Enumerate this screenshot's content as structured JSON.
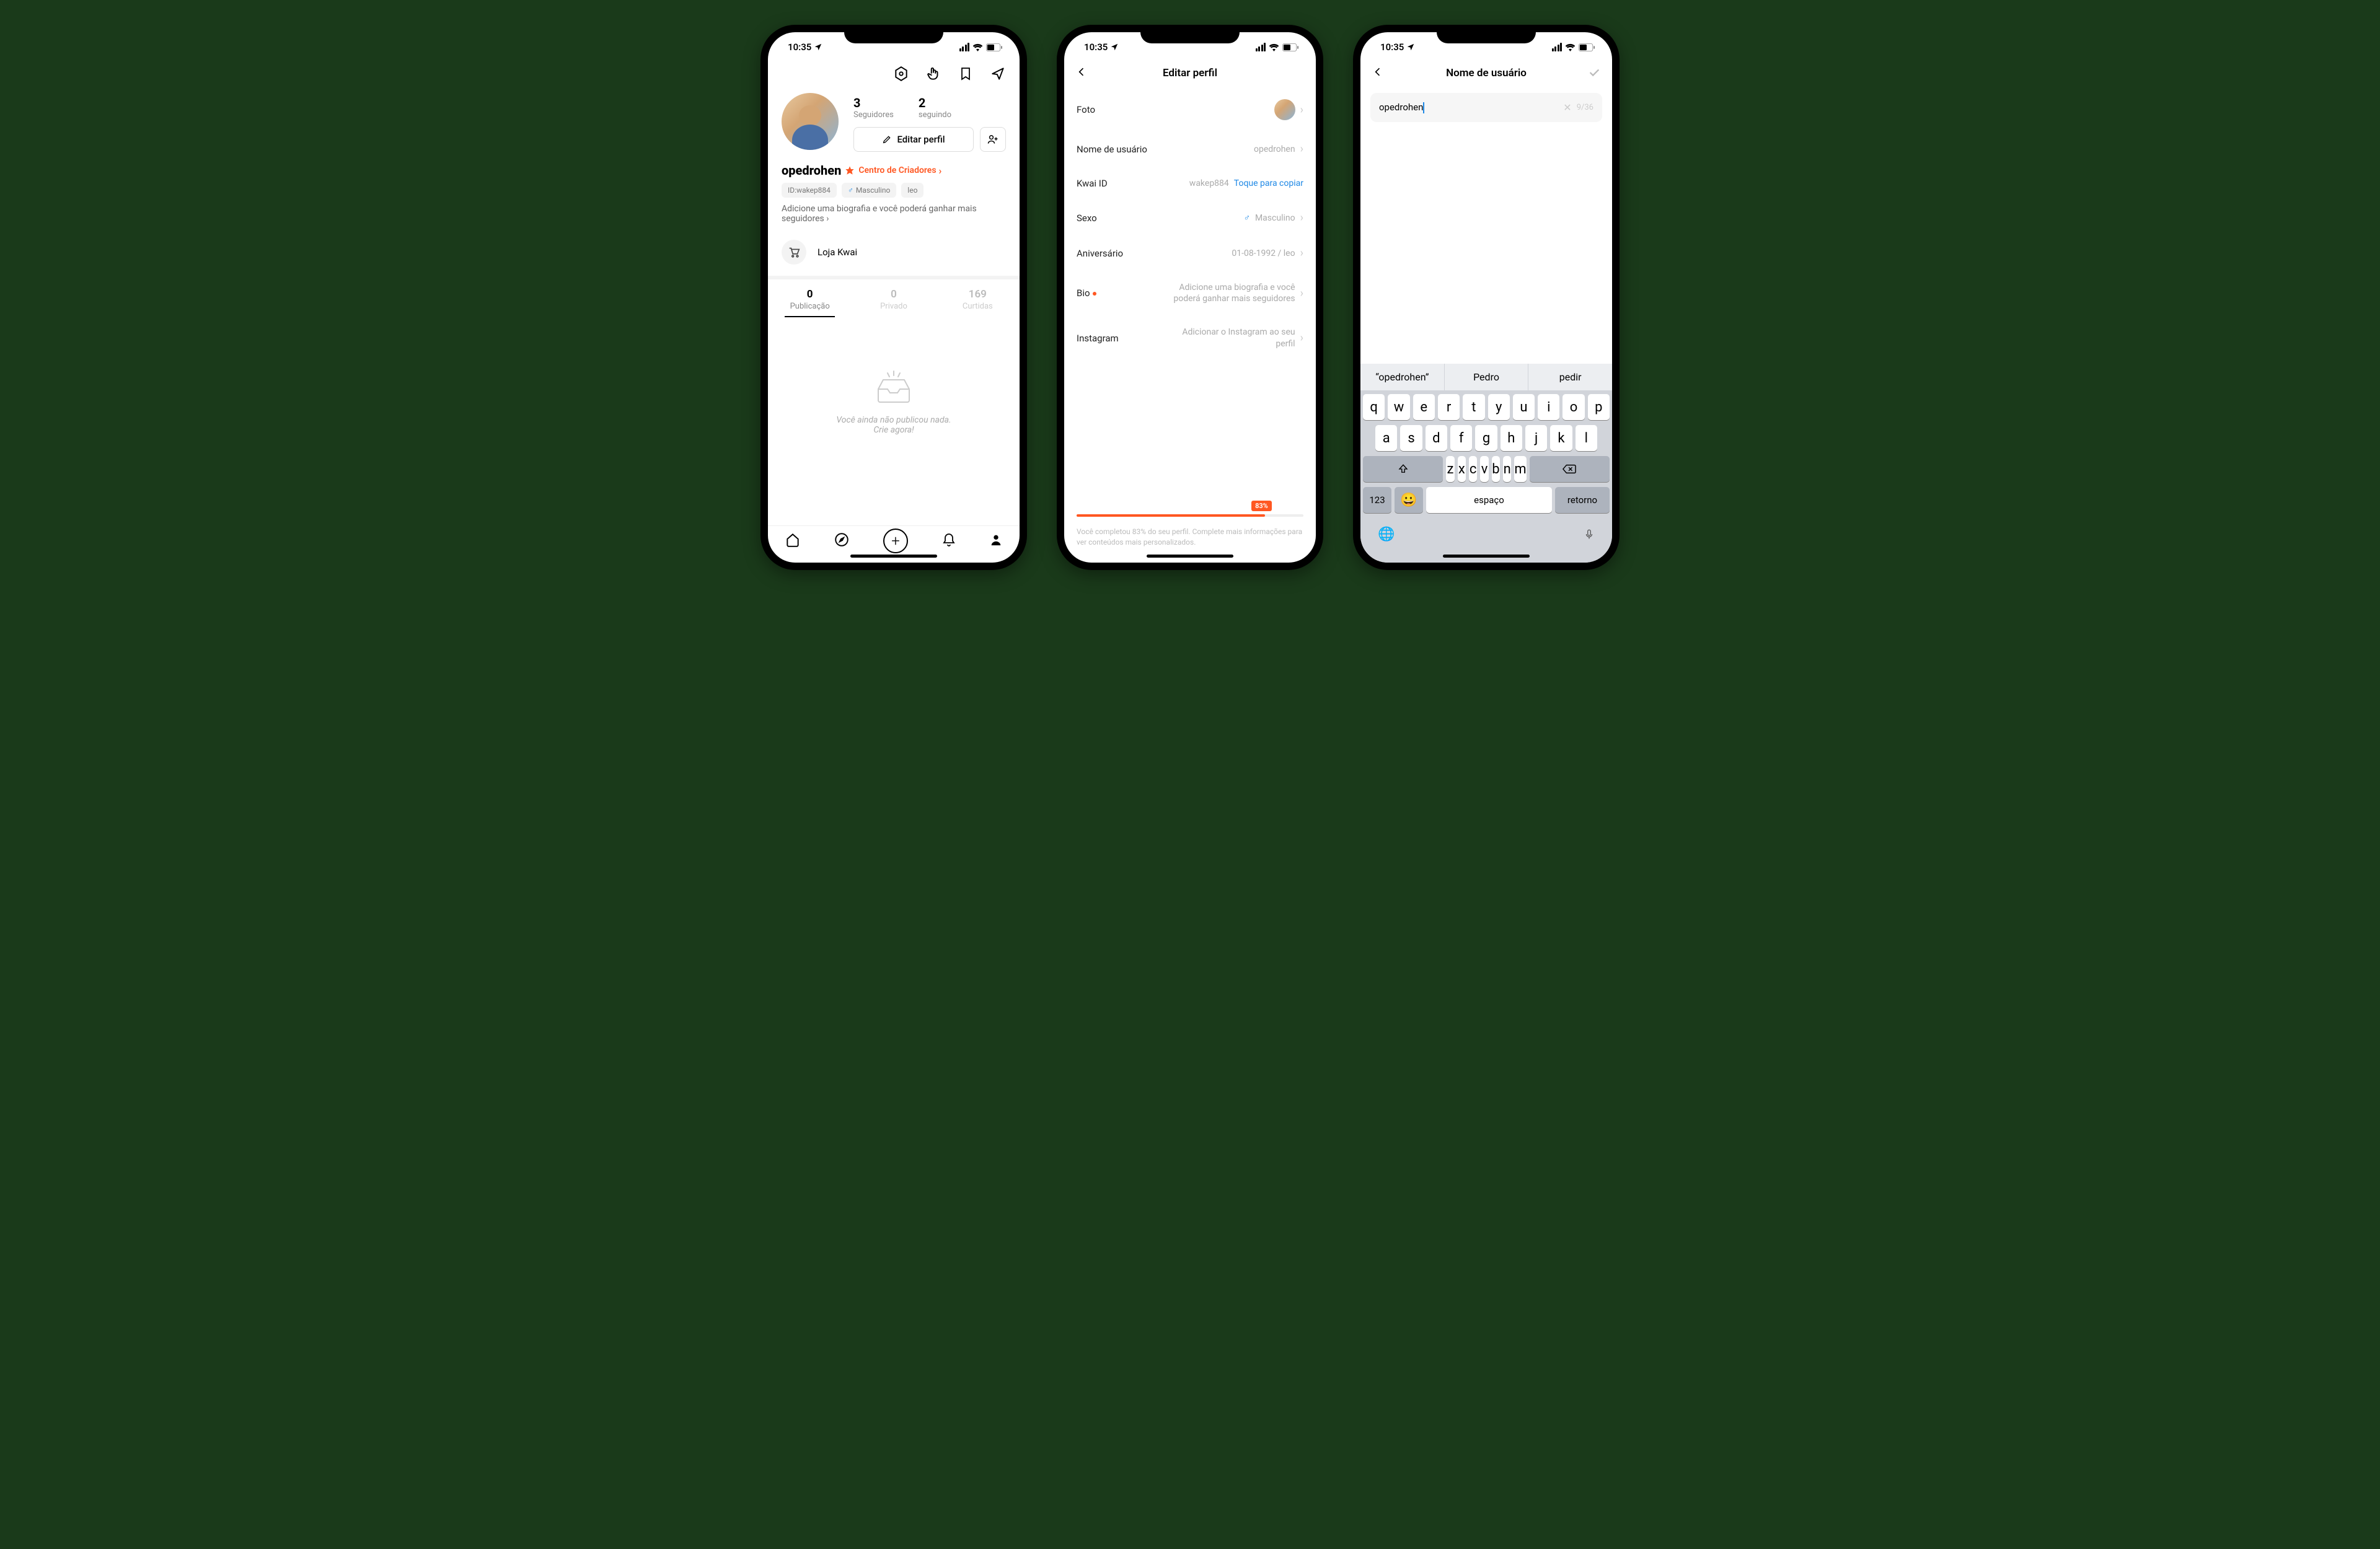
{
  "status": {
    "time": "10:35"
  },
  "screen1": {
    "followers_n": "3",
    "followers_l": "Seguidores",
    "following_n": "2",
    "following_l": "seguindo",
    "edit_btn": "Editar perfil",
    "username": "opedrohen",
    "creator_center": "Centro de Criadores",
    "id_chip": "ID:wakep884",
    "gender_chip": "Masculino",
    "sign_chip": "leo",
    "bio_prompt": "Adicione uma biografia e você poderá ganhar mais seguidores ›",
    "store": "Loja Kwai",
    "tab1_n": "0",
    "tab1_l": "Publicação",
    "tab2_n": "0",
    "tab2_l": "Privado",
    "tab3_n": "169",
    "tab3_l": "Curtidas",
    "empty1": "Você ainda não publicou nada.",
    "empty2": "Crie agora!"
  },
  "screen2": {
    "title": "Editar perfil",
    "photo_l": "Foto",
    "uname_l": "Nome de usuário",
    "uname_v": "opedrohen",
    "kid_l": "Kwai ID",
    "kid_v": "wakep884",
    "kid_copy": "Toque para copiar",
    "sex_l": "Sexo",
    "sex_v": "Masculino",
    "bday_l": "Aniversário",
    "bday_v": "01-08-1992 / leo",
    "bio_l": "Bio",
    "bio_v": "Adicione uma biografia e você poderá ganhar mais seguidores",
    "ig_l": "Instagram",
    "ig_v": "Adicionar o Instagram ao seu perfil",
    "progress_pct": "83%",
    "progress_txt": "Você completou 83% do  seu perfil. Complete mais informações para ver conteúdos mais personalizados."
  },
  "screen3": {
    "title": "Nome de usuário",
    "value": "opedrohen",
    "count": "9/36",
    "sug1": "“opedrohen”",
    "sug2": "Pedro",
    "sug3": "pedir",
    "row1": [
      "q",
      "w",
      "e",
      "r",
      "t",
      "y",
      "u",
      "i",
      "o",
      "p"
    ],
    "row2": [
      "a",
      "s",
      "d",
      "f",
      "g",
      "h",
      "j",
      "k",
      "l"
    ],
    "row3": [
      "z",
      "x",
      "c",
      "v",
      "b",
      "n",
      "m"
    ],
    "k123": "123",
    "kspace": "espaço",
    "kret": "retorno"
  }
}
